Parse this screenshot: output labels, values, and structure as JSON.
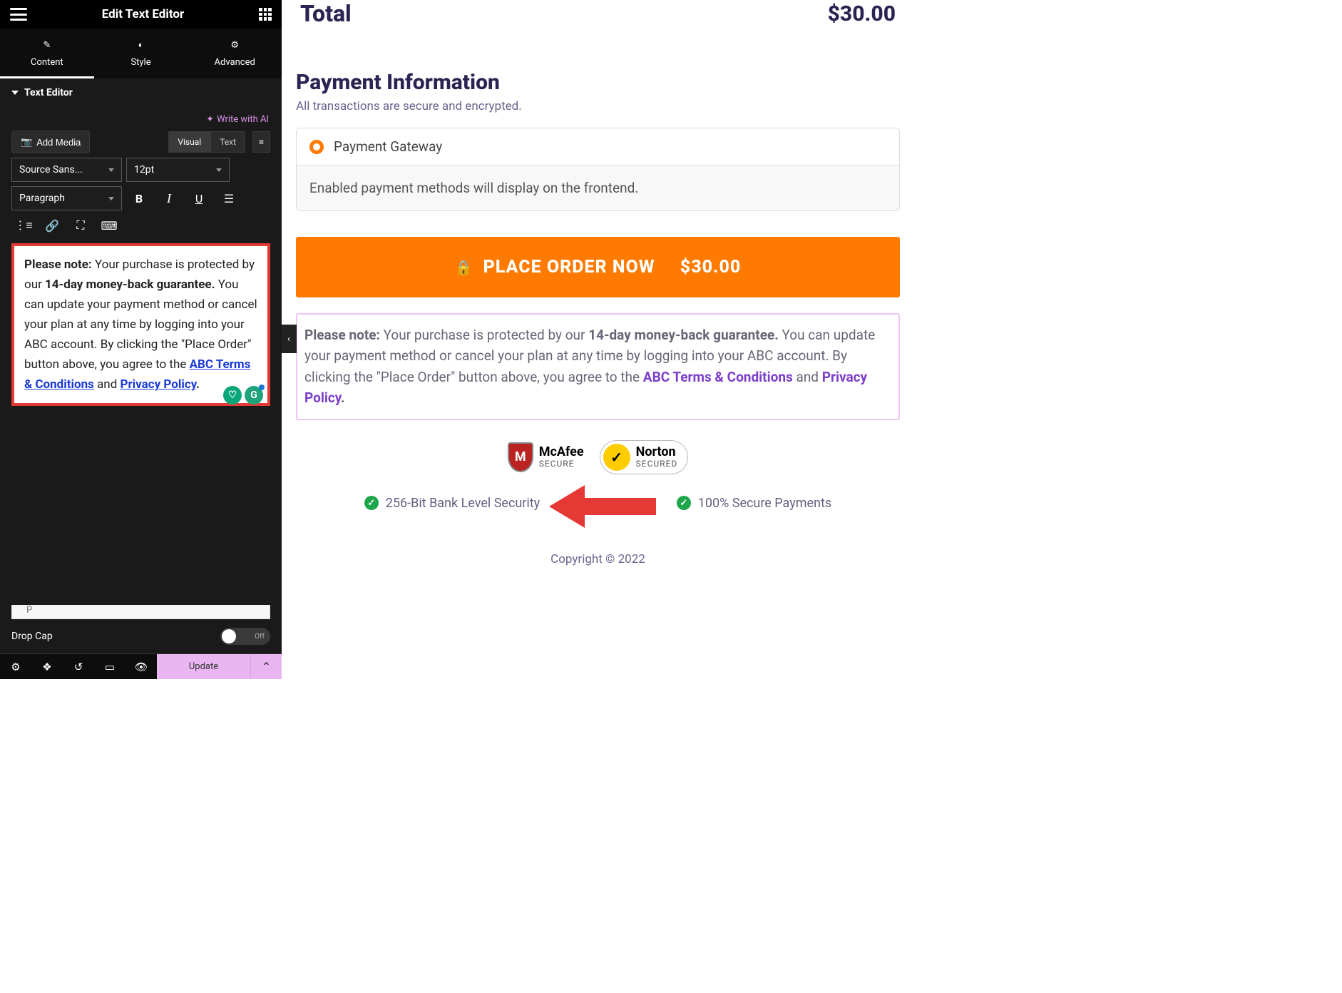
{
  "header": {
    "title": "Edit Text Editor"
  },
  "tabs": {
    "content": "Content",
    "style": "Style",
    "advanced": "Advanced"
  },
  "section": {
    "title": "Text Editor"
  },
  "ai": {
    "label": "Write with AI"
  },
  "media": {
    "add_media": "Add Media",
    "visual": "Visual",
    "text": "Text"
  },
  "toolbar": {
    "font": "Source Sans...",
    "size": "12pt",
    "paragraph": "Paragraph"
  },
  "editor": {
    "note_label": "Please note:",
    "body1": " Your purchase is protected by our ",
    "guarantee": "14-day money-back guarantee.",
    "body2": " You can update your payment method or cancel your plan at any time by logging into your ABC account. By clicking the \"Place Order\" button above, you agree to the ",
    "terms": "ABC Terms & Conditions",
    "and": " and ",
    "privacy": "Privacy Policy",
    "period": ".",
    "path": "P"
  },
  "dropcap": {
    "label": "Drop Cap",
    "state": "Off"
  },
  "footer": {
    "update": "Update"
  },
  "preview": {
    "total_label": "Total",
    "total_amount": "$30.00",
    "pay_title": "Payment Information",
    "pay_sub": "All transactions are secure and encrypted.",
    "gateway_label": "Payment Gateway",
    "gateway_body": "Enabled payment methods will display on the frontend.",
    "order_label": "PLACE ORDER NOW",
    "order_amount": "$30.00",
    "note_label": "Please note:",
    "note_body1": " Your purchase is protected by our ",
    "note_guarantee": "14-day money-back guarantee.",
    "note_body2": " You can update your payment method or cancel your plan at any time by logging into your ABC account. By clicking the \"Place Order\" button above, you agree to the ",
    "note_terms": "ABC Terms & Conditions",
    "note_and": " and ",
    "note_privacy": "Privacy Policy",
    "note_period": ".",
    "mcafee_t1": "McAfee",
    "mcafee_t2": "SECURE",
    "norton_t1": "Norton",
    "norton_t2": "SECURED",
    "feat1": "256-Bit Bank Level Security",
    "feat2": "100% Secure Payments",
    "copyright": "Copyright © 2022"
  }
}
